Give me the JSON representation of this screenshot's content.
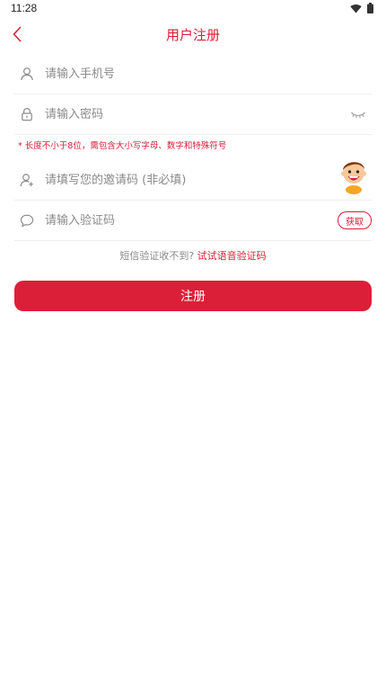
{
  "status_bar": {
    "time": "11:28"
  },
  "nav": {
    "title": "用户注册"
  },
  "form": {
    "phone_placeholder": "请输入手机号",
    "password_placeholder": "请输入密码",
    "password_hint": "* 长度不小于8位，需包含大小写字母、数字和特殊符号",
    "invite_placeholder": "请填写您的邀请码 (非必填)",
    "code_placeholder": "请输入验证码",
    "get_code_label": "获取"
  },
  "voice": {
    "prompt": "短信验证收不到? ",
    "link": "试试语音验证码"
  },
  "register_label": "注册",
  "colors": {
    "accent": "#dc1f38"
  }
}
